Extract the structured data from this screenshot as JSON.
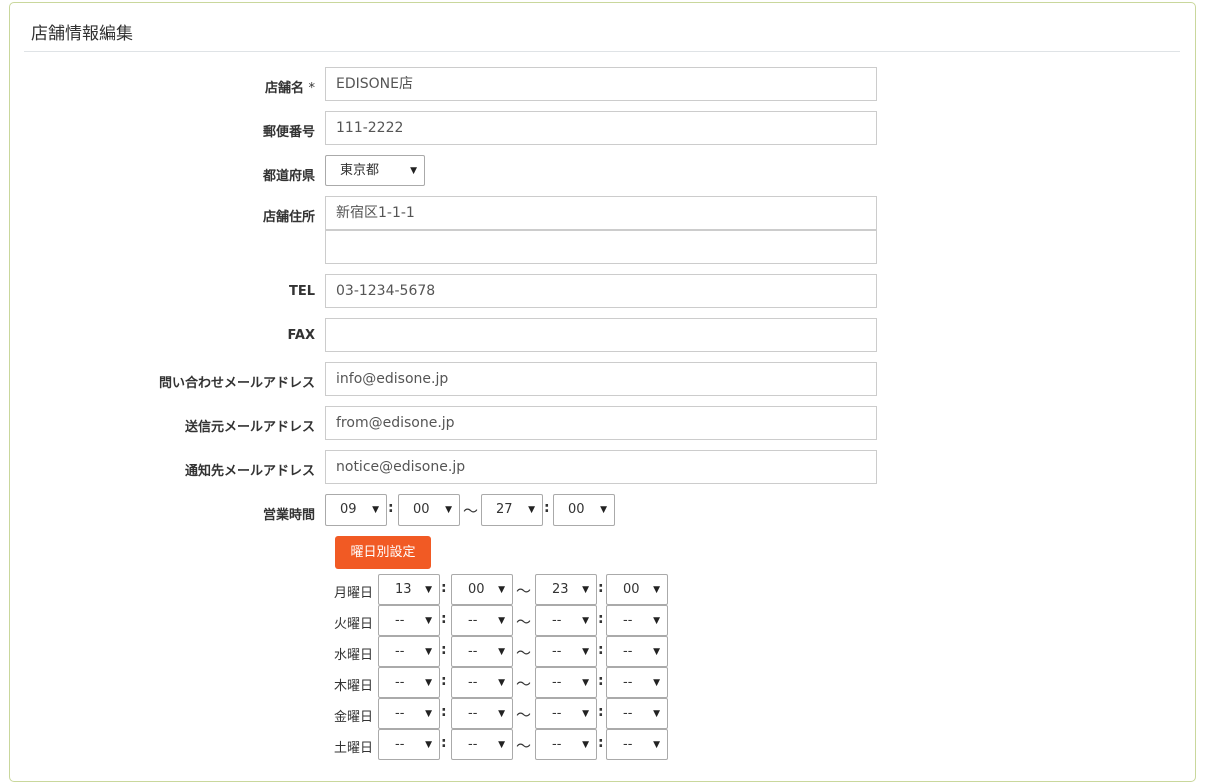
{
  "panel": {
    "title": "店舗情報編集"
  },
  "form": {
    "store_name": {
      "label": "店舗名",
      "required": "*",
      "value": "EDISONE店"
    },
    "postal_code": {
      "label": "郵便番号",
      "value": "111-2222"
    },
    "prefecture": {
      "label": "都道府県",
      "value": "東京都"
    },
    "address": {
      "label": "店舗住所",
      "line1": "新宿区1-1-1",
      "line2": ""
    },
    "tel": {
      "label": "TEL",
      "value": "03-1234-5678"
    },
    "fax": {
      "label": "FAX",
      "value": ""
    },
    "contact_email": {
      "label": "問い合わせメールアドレス",
      "value": "info@edisone.jp"
    },
    "sender_email": {
      "label": "送信元メールアドレス",
      "value": "from@edisone.jp"
    },
    "notice_email": {
      "label": "通知先メールアドレス",
      "value": "notice@edisone.jp"
    },
    "hours": {
      "label": "営業時間",
      "open_hour": "09",
      "open_min": "00",
      "close_hour": "27",
      "close_min": "00"
    },
    "weekday_button": "曜日別設定",
    "days": [
      {
        "label": "月曜日",
        "open_hour": "13",
        "open_min": "00",
        "close_hour": "23",
        "close_min": "00"
      },
      {
        "label": "火曜日",
        "open_hour": "--",
        "open_min": "--",
        "close_hour": "--",
        "close_min": "--"
      },
      {
        "label": "水曜日",
        "open_hour": "--",
        "open_min": "--",
        "close_hour": "--",
        "close_min": "--"
      },
      {
        "label": "木曜日",
        "open_hour": "--",
        "open_min": "--",
        "close_hour": "--",
        "close_min": "--"
      },
      {
        "label": "金曜日",
        "open_hour": "--",
        "open_min": "--",
        "close_hour": "--",
        "close_min": "--"
      },
      {
        "label": "土曜日",
        "open_hour": "--",
        "open_min": "--",
        "close_hour": "--",
        "close_min": "--"
      }
    ]
  },
  "symbols": {
    "colon": ":",
    "tilde": "〜",
    "arrow": "▼"
  },
  "colors": {
    "accent": "#f15a24",
    "panel_border": "#c9d79c"
  }
}
